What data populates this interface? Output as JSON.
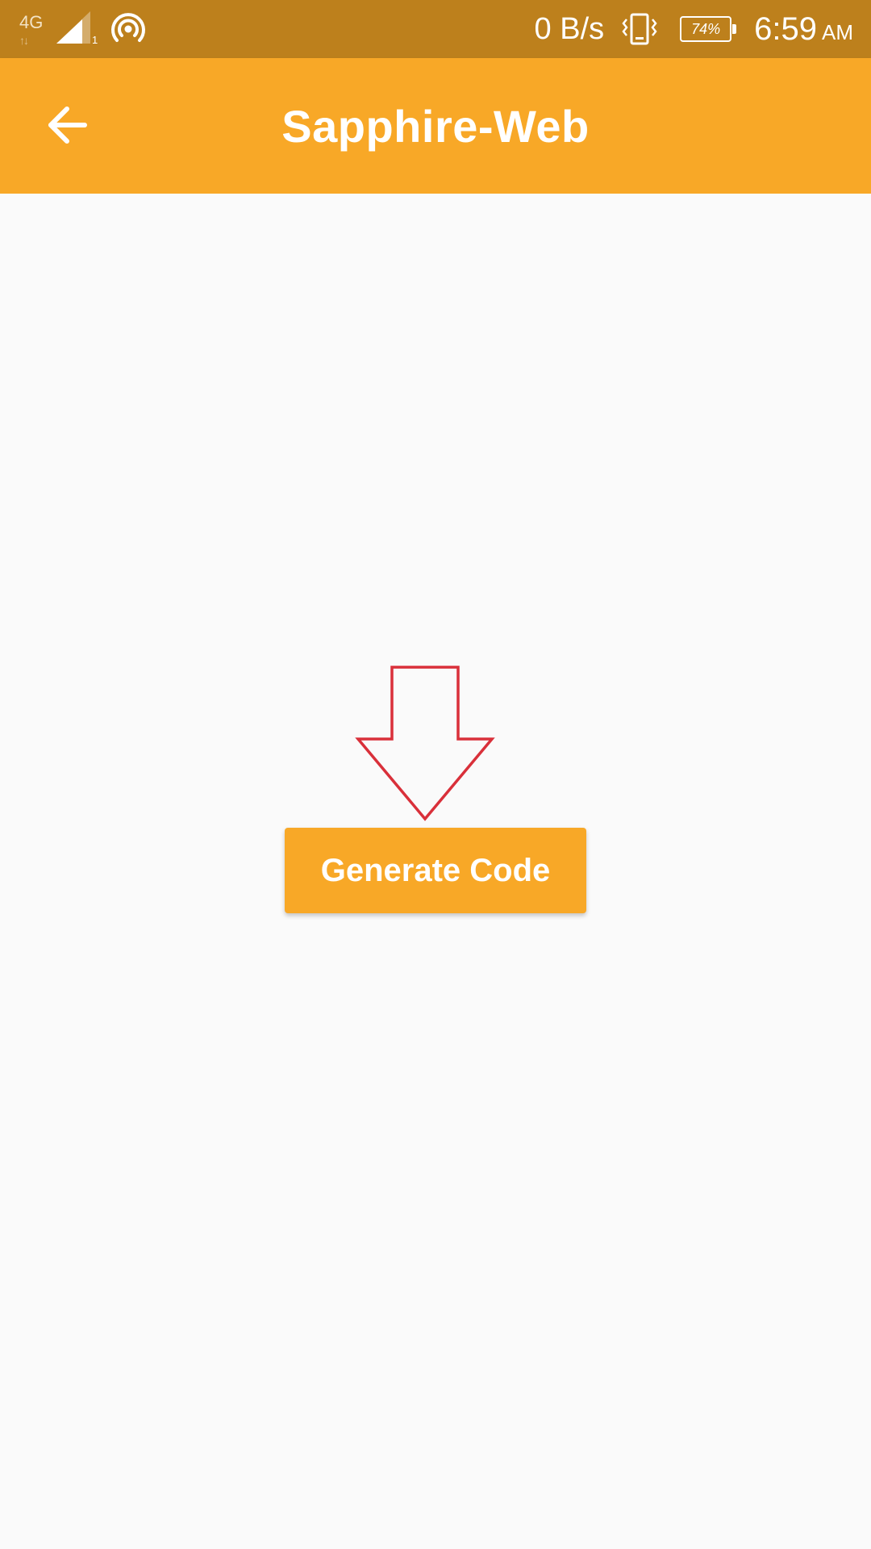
{
  "status_bar": {
    "network_type": "4G",
    "sim_number": "1",
    "data_speed": "0 B/s",
    "battery_level": "74%",
    "time": "6:59",
    "ampm": "AM",
    "icons": [
      "network-4g-icon",
      "signal-icon",
      "hotspot-icon",
      "vibrate-icon",
      "battery-icon"
    ]
  },
  "app_bar": {
    "title": "Sapphire-Web",
    "back_icon": "arrow-back-icon"
  },
  "main": {
    "annotation_icon": "arrow-down-outline-icon",
    "generate_button_label": "Generate Code"
  },
  "colors": {
    "status_bar_bg": "#bd801c",
    "app_bar_bg": "#f8a827",
    "button_bg": "#f8a827",
    "page_bg": "#fafafa",
    "annotation_arrow": "#d9303a"
  }
}
